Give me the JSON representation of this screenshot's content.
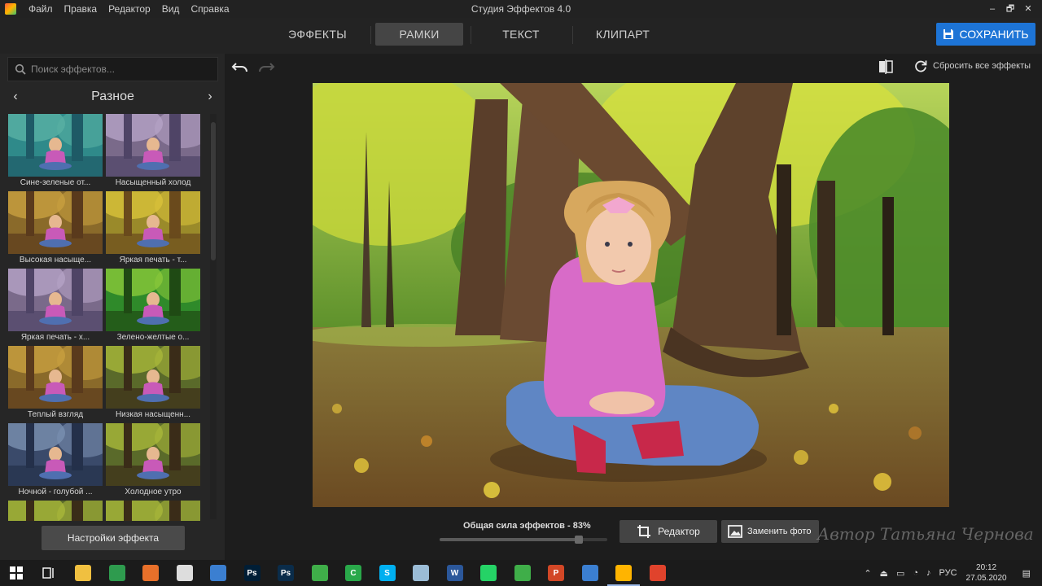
{
  "window": {
    "title": "Студия Эффектов 4.0",
    "menu": [
      "Файл",
      "Правка",
      "Редактор",
      "Вид",
      "Справка"
    ]
  },
  "tabs": [
    {
      "label": "ЭФФЕКТЫ",
      "active": false
    },
    {
      "label": "РАМКИ",
      "active": true
    },
    {
      "label": "ТЕКСТ",
      "active": false
    },
    {
      "label": "КЛИПАРТ",
      "active": false
    }
  ],
  "save_button": {
    "label": "СОХРАНИТЬ",
    "icon": "floppy-icon",
    "color": "#1d74d6"
  },
  "sidebar": {
    "search_placeholder": "Поиск эффектов...",
    "category": "Разное",
    "effects": [
      {
        "label": "Сине-зеленые от...",
        "tint": "teal"
      },
      {
        "label": "Насыщенный холод",
        "tint": "cold"
      },
      {
        "label": "Высокая насыще...",
        "tint": "warm"
      },
      {
        "label": "Яркая печать - т...",
        "tint": "bright"
      },
      {
        "label": "Яркая печать - х...",
        "tint": "cold"
      },
      {
        "label": "Зелено-желтые о...",
        "tint": "green"
      },
      {
        "label": "Теплый взгляд",
        "tint": "warm"
      },
      {
        "label": "Низкая насыщенн...",
        "tint": "normal"
      },
      {
        "label": "Ночной - голубой ...",
        "tint": "night"
      },
      {
        "label": "Холодное утро",
        "tint": "normal"
      },
      {
        "label": "",
        "tint": "normal"
      },
      {
        "label": "",
        "tint": "normal"
      }
    ],
    "settings_button": "Настройки эффекта"
  },
  "workspace": {
    "reset_label": "Сбросить все эффекты",
    "strength_label": "Общая сила эффектов - 83%",
    "strength_value": 0.83,
    "editor_button": "Редактор",
    "replace_button": "Заменить фото",
    "watermark": "Автор Татьяна Чернова"
  },
  "taskbar": {
    "apps": [
      {
        "name": "file-explorer-icon",
        "glyph": "",
        "color": "#f0c040"
      },
      {
        "name": "chrome-icon",
        "glyph": "",
        "color": "#2e9b4e"
      },
      {
        "name": "firefox-icon",
        "glyph": "",
        "color": "#e8702a"
      },
      {
        "name": "app-icon-generic",
        "glyph": "",
        "color": "#ddd"
      },
      {
        "name": "globe-icon",
        "glyph": "",
        "color": "#3b7fd1"
      },
      {
        "name": "photoshop-icon",
        "glyph": "Ps",
        "color": "#001e36"
      },
      {
        "name": "photoshop-icon-2",
        "glyph": "Ps",
        "color": "#0a2c4a"
      },
      {
        "name": "leaf-icon",
        "glyph": "",
        "color": "#3fae49"
      },
      {
        "name": "camtasia-icon",
        "glyph": "C",
        "color": "#29a84a"
      },
      {
        "name": "skype-icon",
        "glyph": "S",
        "color": "#00aff0"
      },
      {
        "name": "cube-icon",
        "glyph": "",
        "color": "#9bbcd6"
      },
      {
        "name": "word-icon",
        "glyph": "W",
        "color": "#2b579a"
      },
      {
        "name": "whatsapp-icon",
        "glyph": "",
        "color": "#25d366"
      },
      {
        "name": "leaf-icon-2",
        "glyph": "",
        "color": "#3fae49"
      },
      {
        "name": "powerpoint-icon",
        "glyph": "P",
        "color": "#d24726"
      },
      {
        "name": "globe-icon-2",
        "glyph": "",
        "color": "#3b7fd1"
      },
      {
        "name": "effects-studio-icon",
        "glyph": "",
        "color": "#ffb400",
        "active": true
      },
      {
        "name": "red-app-icon",
        "glyph": "",
        "color": "#e0432c"
      }
    ],
    "language": "РУС",
    "time": "20:12",
    "date": "27.05.2020"
  }
}
